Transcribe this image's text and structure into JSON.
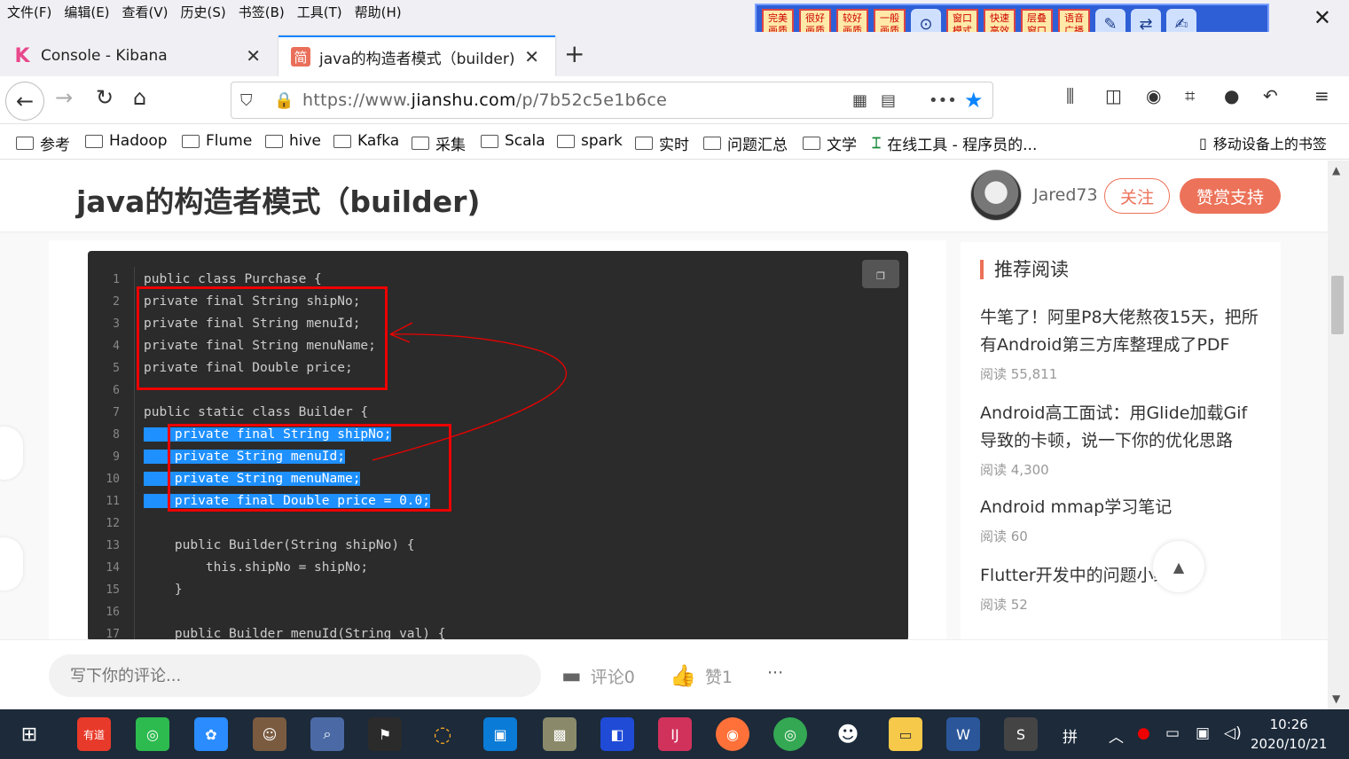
{
  "menu": [
    "文件(F)",
    "编辑(E)",
    "查看(V)",
    "历史(S)",
    "书签(B)",
    "工具(T)",
    "帮助(H)"
  ],
  "ext_toolbar": [
    "完美画质",
    "很好画质",
    "较好画质",
    "一般画质",
    "窗口模式",
    "快速高效",
    "层叠窗口",
    "语音广播"
  ],
  "tabs": [
    {
      "label": "Console - Kibana"
    },
    {
      "label": "java的构造者模式（builder)"
    }
  ],
  "url": {
    "prefix": "https://www.",
    "domain": "jianshu.com",
    "path": "/p/7b52c5e1b6ce"
  },
  "bookmarks": [
    "参考",
    "Hadoop",
    "Flume",
    "hive",
    "Kafka",
    "采集",
    "Scala",
    "spark",
    "实时",
    "问题汇总",
    "文学",
    "在线工具 - 程序员的...",
    "移动设备上的书签"
  ],
  "article": {
    "title": "java的构造者模式（builder)",
    "author": "Jared73",
    "follow_label": "关注",
    "reward_label": "赞赏支持"
  },
  "code": {
    "line_numbers": [
      "1",
      "2",
      "3",
      "4",
      "5",
      "6",
      "7",
      "8",
      "9",
      "10",
      "11",
      "12",
      "13",
      "14",
      "15",
      "16",
      "17"
    ],
    "lines": [
      "public class Purchase {",
      "private final String shipNo;",
      "private final String menuId;",
      "private final String menuName;",
      "private final Double price;",
      "",
      "public static class Builder {",
      "    private final String shipNo;",
      "    private String menuId;",
      "    private String menuName;",
      "    private final Double price = 0.0;",
      "",
      "    public Builder(String shipNo) {",
      "        this.shipNo = shipNo;",
      "    }",
      "",
      "    public Builder menuId(String val) {"
    ]
  },
  "sidebar": {
    "title": "推荐阅读",
    "items": [
      {
        "title": "牛笔了！阿里P8大佬熬夜15天，把所有Android第三方库整理成了PDF",
        "reads": "阅读 55,811"
      },
      {
        "title": "Android高工面试：用Glide加载Gif导致的卡顿，说一下你的优化思路",
        "reads": "阅读 4,300"
      },
      {
        "title": "Android mmap学习笔记",
        "reads": "阅读 60"
      },
      {
        "title": "Flutter开发中的问题小结",
        "reads": "阅读 52"
      }
    ]
  },
  "comment": {
    "placeholder": "写下你的评论...",
    "comment_label": "评论0",
    "like_label": "赞1",
    "more_label": "···"
  },
  "taskbar": {
    "time": "10:26",
    "date": "2020/10/21",
    "ime": "拼"
  },
  "colors": {
    "accent": "#ec7259",
    "selection": "#1e90ff",
    "annotation": "#ee0000"
  }
}
